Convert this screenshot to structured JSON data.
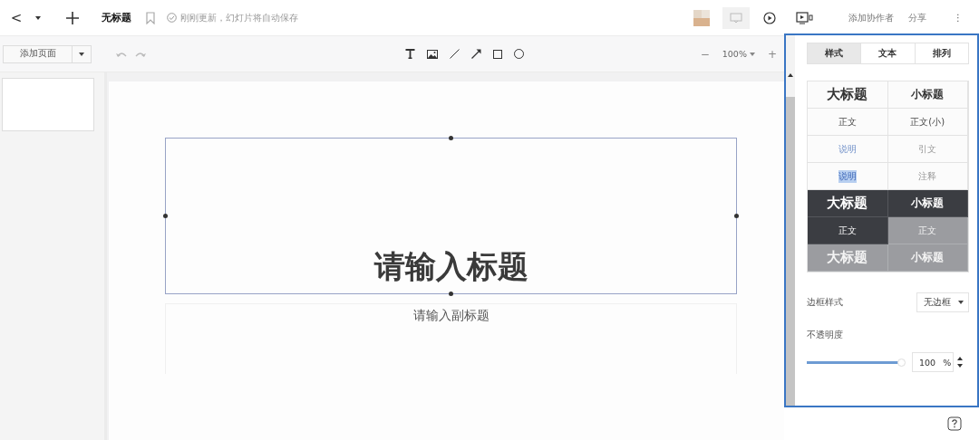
{
  "top_bar": {
    "back": "<",
    "title": "无标题",
    "save_status": "刚刚更新，幻灯片将自动保存",
    "add_collaborator": "添加协作者",
    "share": "分享",
    "more": "⋮"
  },
  "toolbar": {
    "add_page": "添加页面",
    "zoom": "100%",
    "zoom_out": "−",
    "zoom_in": "+"
  },
  "slide": {
    "title_placeholder": "请输入标题",
    "subtitle_placeholder": "请输入副标题"
  },
  "panel": {
    "tabs": [
      {
        "label": "样式",
        "selected": true
      },
      {
        "label": "文本",
        "selected": false
      },
      {
        "label": "排列",
        "selected": false
      }
    ],
    "styles": [
      {
        "text": "大标题",
        "kind": "large",
        "color": "#fbfbfb"
      },
      {
        "text": "小标题",
        "kind": "small-title",
        "color": "#fbfbfb"
      },
      {
        "text": "正文",
        "kind": "body",
        "color": "#fbfbfb"
      },
      {
        "text": "正文(小)",
        "kind": "body",
        "color": "#fbfbfb"
      },
      {
        "text": "说明",
        "kind": "caption",
        "color": "#fbfbfb"
      },
      {
        "text": "引文",
        "kind": "quote",
        "color": "#fbfbfb"
      },
      {
        "text": "说明",
        "kind": "marked",
        "color": "#fbfbfb"
      },
      {
        "text": "注释",
        "kind": "note",
        "color": "#fbfbfb"
      },
      {
        "text": "大标题",
        "kind": "large",
        "color": "#3b3d42"
      },
      {
        "text": "小标题",
        "kind": "small-title",
        "color": "#3b3d42"
      },
      {
        "text": "正文",
        "kind": "body",
        "color": "#3b3d42"
      },
      {
        "text": "正文",
        "kind": "body",
        "color": "#9b9ca0"
      },
      {
        "text": "大标题",
        "kind": "large",
        "color": "#9b9ca0"
      },
      {
        "text": "小标题",
        "kind": "small-title",
        "color": "#9b9ca0"
      }
    ],
    "border_label": "边框样式",
    "border_value": "无边框",
    "opacity_label": "不透明度",
    "opacity": {
      "level": 1,
      "value": "100",
      "unit": "%"
    }
  }
}
